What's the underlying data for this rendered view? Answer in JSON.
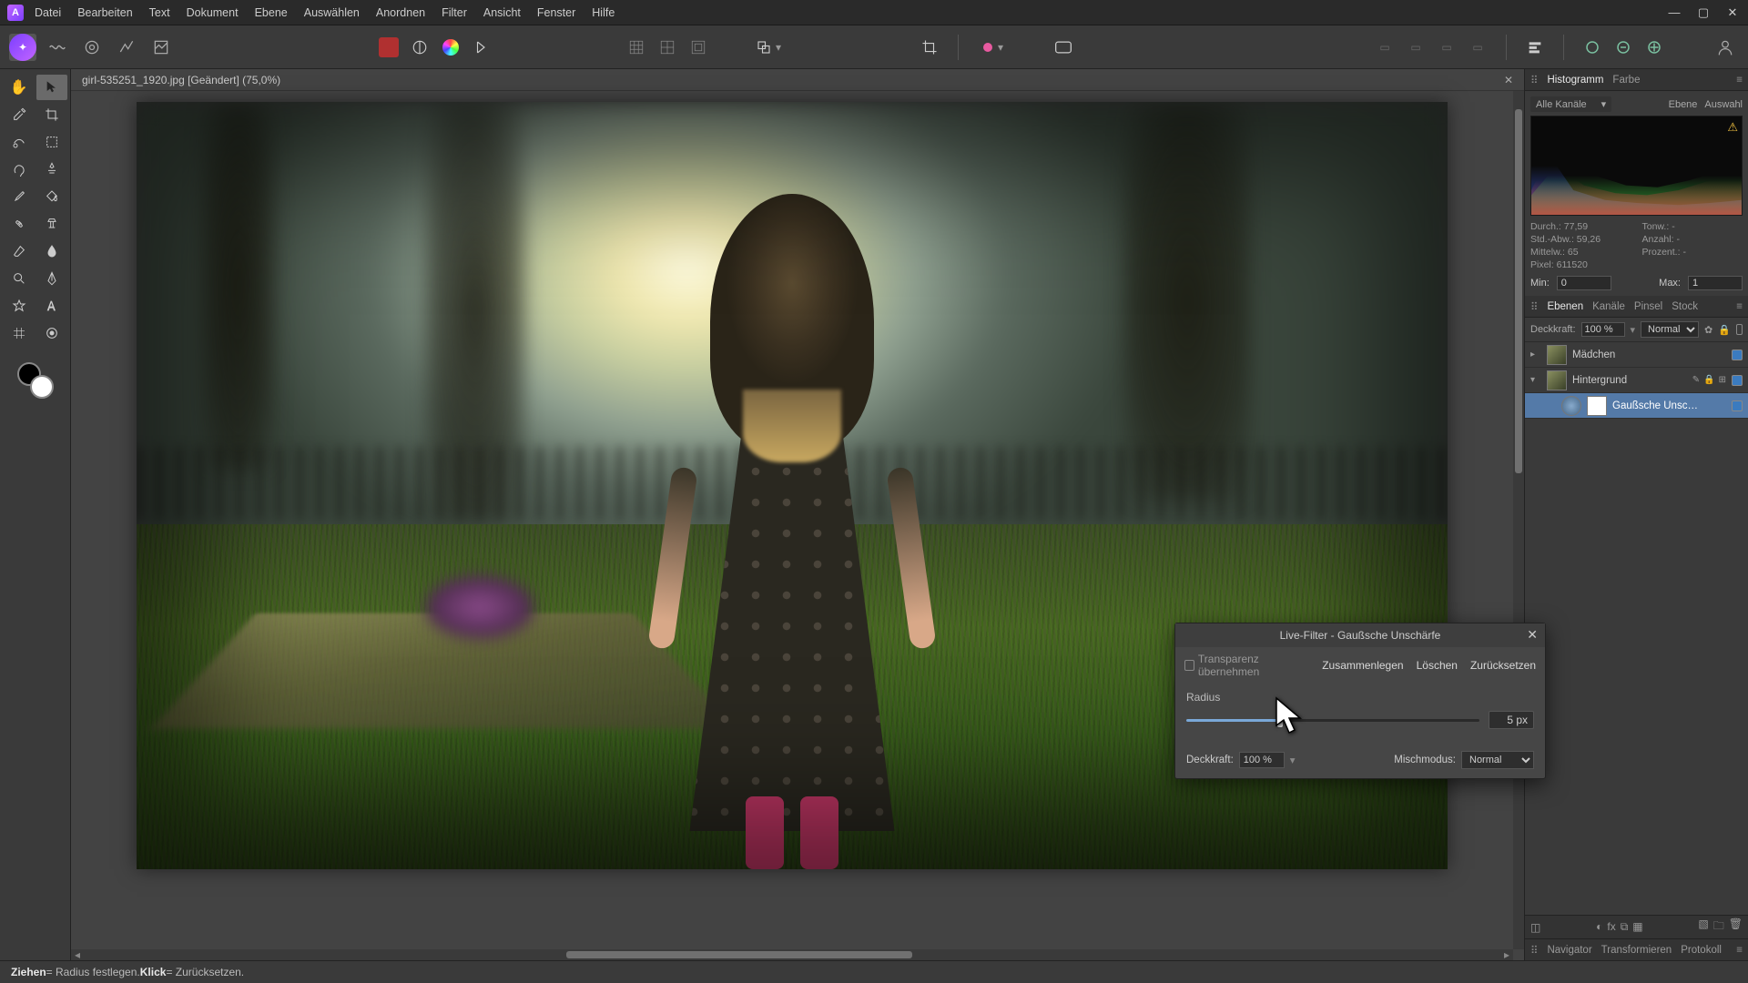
{
  "menu": {
    "items": [
      "Datei",
      "Bearbeiten",
      "Text",
      "Dokument",
      "Ebene",
      "Auswählen",
      "Anordnen",
      "Filter",
      "Ansicht",
      "Fenster",
      "Hilfe"
    ]
  },
  "document": {
    "tab_title": "girl-535251_1920.jpg [Geändert] (75,0%)"
  },
  "histogram": {
    "tabs": {
      "histogram": "Histogramm",
      "color": "Farbe"
    },
    "channel_sel": "Alle Kanäle",
    "layer_btn": "Ebene",
    "selection_btn": "Auswahl",
    "stats": {
      "mean_label": "Durch.:",
      "mean": "77,59",
      "std_label": "Std.-Abw.:",
      "std": "59,26",
      "median_label": "Mittelw.:",
      "median": "65",
      "pixels_label": "Pixel:",
      "pixels": "611520",
      "tone_label": "Tonw.:",
      "tone": "-",
      "count_label": "Anzahl:",
      "count": "-",
      "perc_label": "Prozent.:",
      "perc": "-"
    },
    "min_label": "Min:",
    "min": "0",
    "max_label": "Max:",
    "max": "1"
  },
  "layers_panel": {
    "tabs": {
      "layers": "Ebenen",
      "channels": "Kanäle",
      "brush": "Pinsel",
      "stock": "Stock"
    },
    "opacity_label": "Deckkraft:",
    "opacity": "100 %",
    "blend": "Normal",
    "layers": [
      {
        "name": "Mädchen"
      },
      {
        "name": "Hintergrund"
      },
      {
        "name": "Gaußsche Unsc…"
      }
    ]
  },
  "bottom_tabs": {
    "navigator": "Navigator",
    "transform": "Transformieren",
    "history": "Protokoll"
  },
  "dialog": {
    "title": "Live-Filter - Gaußsche Unschärfe",
    "preserve_alpha": "Transparenz übernehmen",
    "merge": "Zusammenlegen",
    "delete": "Löschen",
    "reset": "Zurücksetzen",
    "radius_label": "Radius",
    "radius_value": "5 px",
    "opacity_label": "Deckkraft:",
    "opacity_value": "100 %",
    "blend_label": "Mischmodus:",
    "blend_value": "Normal"
  },
  "statusbar": {
    "drag": "Ziehen",
    "drag_desc": " = Radius festlegen. ",
    "click": "Klick",
    "click_desc": " = Zurücksetzen."
  }
}
